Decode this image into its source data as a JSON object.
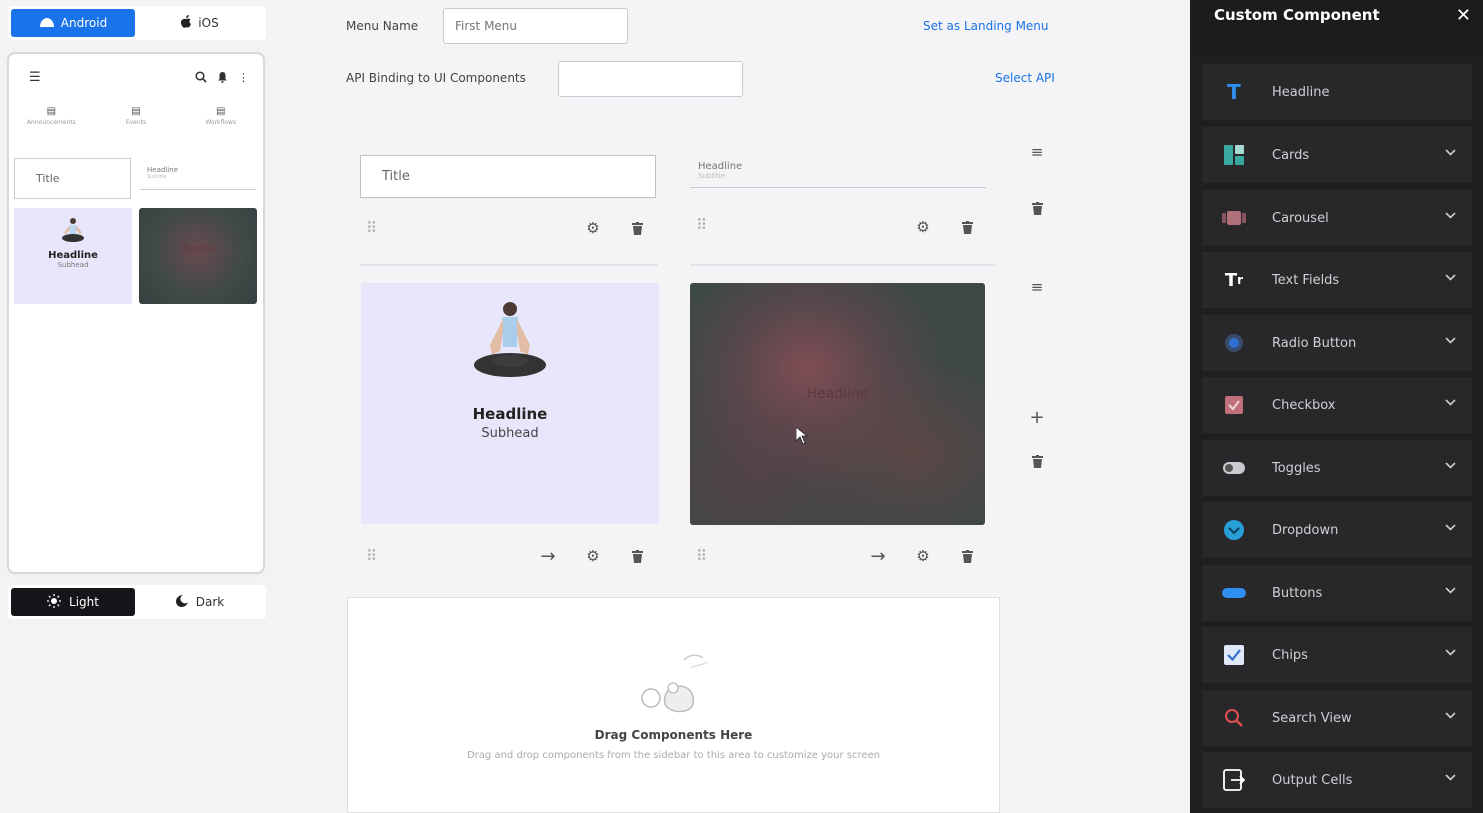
{
  "platform": {
    "android_label": "Android",
    "ios_label": "iOS"
  },
  "phone": {
    "nav": [
      {
        "label": "Announcements"
      },
      {
        "label": "Events"
      },
      {
        "label": "Workflows"
      }
    ],
    "title_field": "Title",
    "headline_field": {
      "label": "Headline",
      "sub": "Subtitle"
    },
    "card1": {
      "headline": "Headline",
      "subhead": "Subhead"
    },
    "card2": {
      "headline": "Headline"
    }
  },
  "theme": {
    "light_label": "Light",
    "dark_label": "Dark"
  },
  "editor": {
    "menu_name_label": "Menu Name",
    "menu_name_value": "First Menu",
    "set_landing_link": "Set as Landing Menu",
    "api_binding_label": "API Binding to UI Components",
    "api_binding_value": "",
    "select_api_link": "Select API",
    "title_input": "Title",
    "headline_input": {
      "label": "Headline",
      "sub": "Subtitle"
    },
    "card_left": {
      "headline": "Headline",
      "subhead": "Subhead"
    },
    "card_right": {
      "headline": "Headline"
    },
    "dropzone_title": "Drag Components Here",
    "dropzone_subtitle": "Drag and drop components from the sidebar to this area to customize your screen"
  },
  "panel": {
    "title": "Custom Component",
    "items": [
      {
        "label": "Headline",
        "icon": "headline-icon",
        "expandable": false,
        "color": "#2f8ff0"
      },
      {
        "label": "Cards",
        "icon": "cards-icon",
        "expandable": true,
        "color": "#3aa99f"
      },
      {
        "label": "Carousel",
        "icon": "carousel-icon",
        "expandable": true,
        "color": "#b0707a"
      },
      {
        "label": "Text Fields",
        "icon": "text-fields-icon",
        "expandable": true,
        "color": "#ffffff"
      },
      {
        "label": "Radio Button",
        "icon": "radio-button-icon",
        "expandable": true,
        "color": "#2f6fd0"
      },
      {
        "label": "Checkbox",
        "icon": "checkbox-icon",
        "expandable": true,
        "color": "#c0707a"
      },
      {
        "label": "Toggles",
        "icon": "toggle-icon",
        "expandable": true,
        "color": "#c9c9cf"
      },
      {
        "label": "Dropdown",
        "icon": "dropdown-icon",
        "expandable": true,
        "color": "#27a0d8"
      },
      {
        "label": "Buttons",
        "icon": "buttons-icon",
        "expandable": true,
        "color": "#2f8ff0"
      },
      {
        "label": "Chips",
        "icon": "chips-icon",
        "expandable": true,
        "color": "#2f6fd0"
      },
      {
        "label": "Search View",
        "icon": "search-view-icon",
        "expandable": true,
        "color": "#e05050"
      },
      {
        "label": "Output Cells",
        "icon": "output-cells-icon",
        "expandable": true,
        "color": "#ffffff"
      }
    ]
  },
  "colors": {
    "accent": "#1a73e8",
    "panel_bg": "#1f1f22",
    "card_lavender": "#e8e6fb"
  }
}
